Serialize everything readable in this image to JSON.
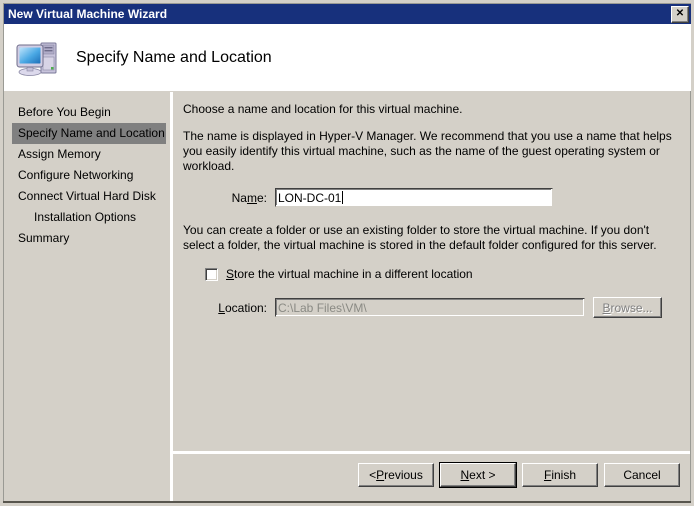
{
  "window": {
    "title": "New Virtual Machine Wizard",
    "close_label": "✕"
  },
  "header": {
    "title": "Specify Name and Location",
    "icon": "computer-icon"
  },
  "sidebar": {
    "items": [
      {
        "label": "Before You Begin",
        "selected": false,
        "indent": false
      },
      {
        "label": "Specify Name and Location",
        "selected": true,
        "indent": false
      },
      {
        "label": "Assign Memory",
        "selected": false,
        "indent": false
      },
      {
        "label": "Configure Networking",
        "selected": false,
        "indent": false
      },
      {
        "label": "Connect Virtual Hard Disk",
        "selected": false,
        "indent": false
      },
      {
        "label": "Installation Options",
        "selected": false,
        "indent": true
      },
      {
        "label": "Summary",
        "selected": false,
        "indent": false
      }
    ]
  },
  "main": {
    "intro": "Choose a name and location for this virtual machine.",
    "description": "The name is displayed in Hyper-V Manager. We recommend that you use a name that helps you easily identify this virtual machine, such as the name of the guest operating system or workload.",
    "name_label_pre": "Na",
    "name_label_accel": "m",
    "name_label_post": "e:",
    "name_value": "LON-DC-01",
    "folder_description": "You can create a folder or use an existing folder to store the virtual machine. If you don't select a folder, the virtual machine is stored in the default folder configured for this server.",
    "store_checkbox_accel": "S",
    "store_checkbox_post": "tore the virtual machine in a different location",
    "store_checkbox_checked": false,
    "location_label_accel": "L",
    "location_label_post": "ocation:",
    "location_value": "C:\\Lab Files\\VM\\",
    "location_enabled": false,
    "browse_accel": "B",
    "browse_post": "rowse...",
    "browse_enabled": false
  },
  "footer": {
    "buttons": [
      {
        "pre": "< ",
        "accel": "P",
        "post": "revious",
        "default": false
      },
      {
        "pre": "",
        "accel": "N",
        "post": "ext >",
        "default": true
      },
      {
        "pre": "",
        "accel": "F",
        "post": "inish",
        "default": false
      },
      {
        "pre": "",
        "accel": "",
        "post": "Cancel",
        "default": false
      }
    ]
  },
  "colors": {
    "titlebar": "#17307c",
    "face": "#d4d0c8",
    "selection": "#808080",
    "header_band": "#ffffff"
  }
}
